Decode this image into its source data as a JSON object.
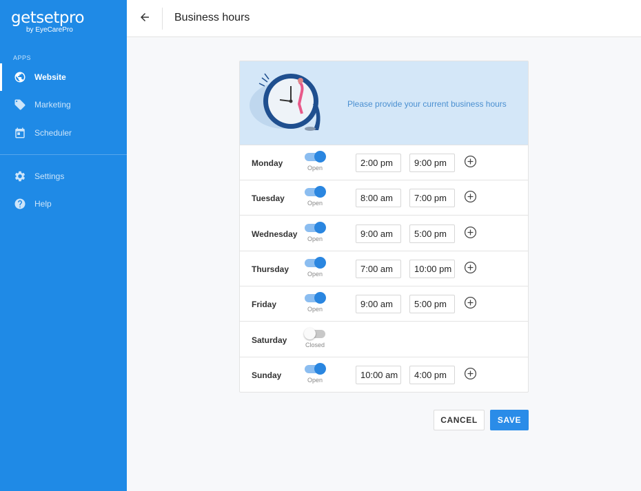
{
  "sidebar": {
    "logo": {
      "brand": "getsetpro",
      "sub": "by EyeCarePro"
    },
    "section_label": "APPS",
    "items": [
      {
        "label": "Website",
        "icon": "globe-icon",
        "active": true
      },
      {
        "label": "Marketing",
        "icon": "tag-icon",
        "active": false
      },
      {
        "label": "Scheduler",
        "icon": "calendar-icon",
        "active": false
      },
      {
        "label": "Settings",
        "icon": "gear-icon",
        "active": false
      },
      {
        "label": "Help",
        "icon": "help-icon",
        "active": false
      }
    ]
  },
  "header": {
    "title": "Business hours",
    "back_icon": "arrow-left-icon"
  },
  "banner": {
    "text": "Please provide your current business hours"
  },
  "days": [
    {
      "name": "Monday",
      "open": true,
      "status": "Open",
      "start": "2:00 pm",
      "end": "9:00 pm"
    },
    {
      "name": "Tuesday",
      "open": true,
      "status": "Open",
      "start": "8:00 am",
      "end": "7:00 pm"
    },
    {
      "name": "Wednesday",
      "open": true,
      "status": "Open",
      "start": "9:00 am",
      "end": "5:00 pm"
    },
    {
      "name": "Thursday",
      "open": true,
      "status": "Open",
      "start": "7:00 am",
      "end": "10:00 pm"
    },
    {
      "name": "Friday",
      "open": true,
      "status": "Open",
      "start": "9:00 am",
      "end": "5:00 pm"
    },
    {
      "name": "Saturday",
      "open": false,
      "status": "Closed",
      "start": "",
      "end": ""
    },
    {
      "name": "Sunday",
      "open": true,
      "status": "Open",
      "start": "10:00 am",
      "end": "4:00 pm"
    }
  ],
  "actions": {
    "cancel": "CANCEL",
    "save": "SAVE"
  },
  "colors": {
    "sidebar": "#1f8ae6",
    "accent": "#2a8ce8",
    "banner": "#d4e7f8"
  }
}
